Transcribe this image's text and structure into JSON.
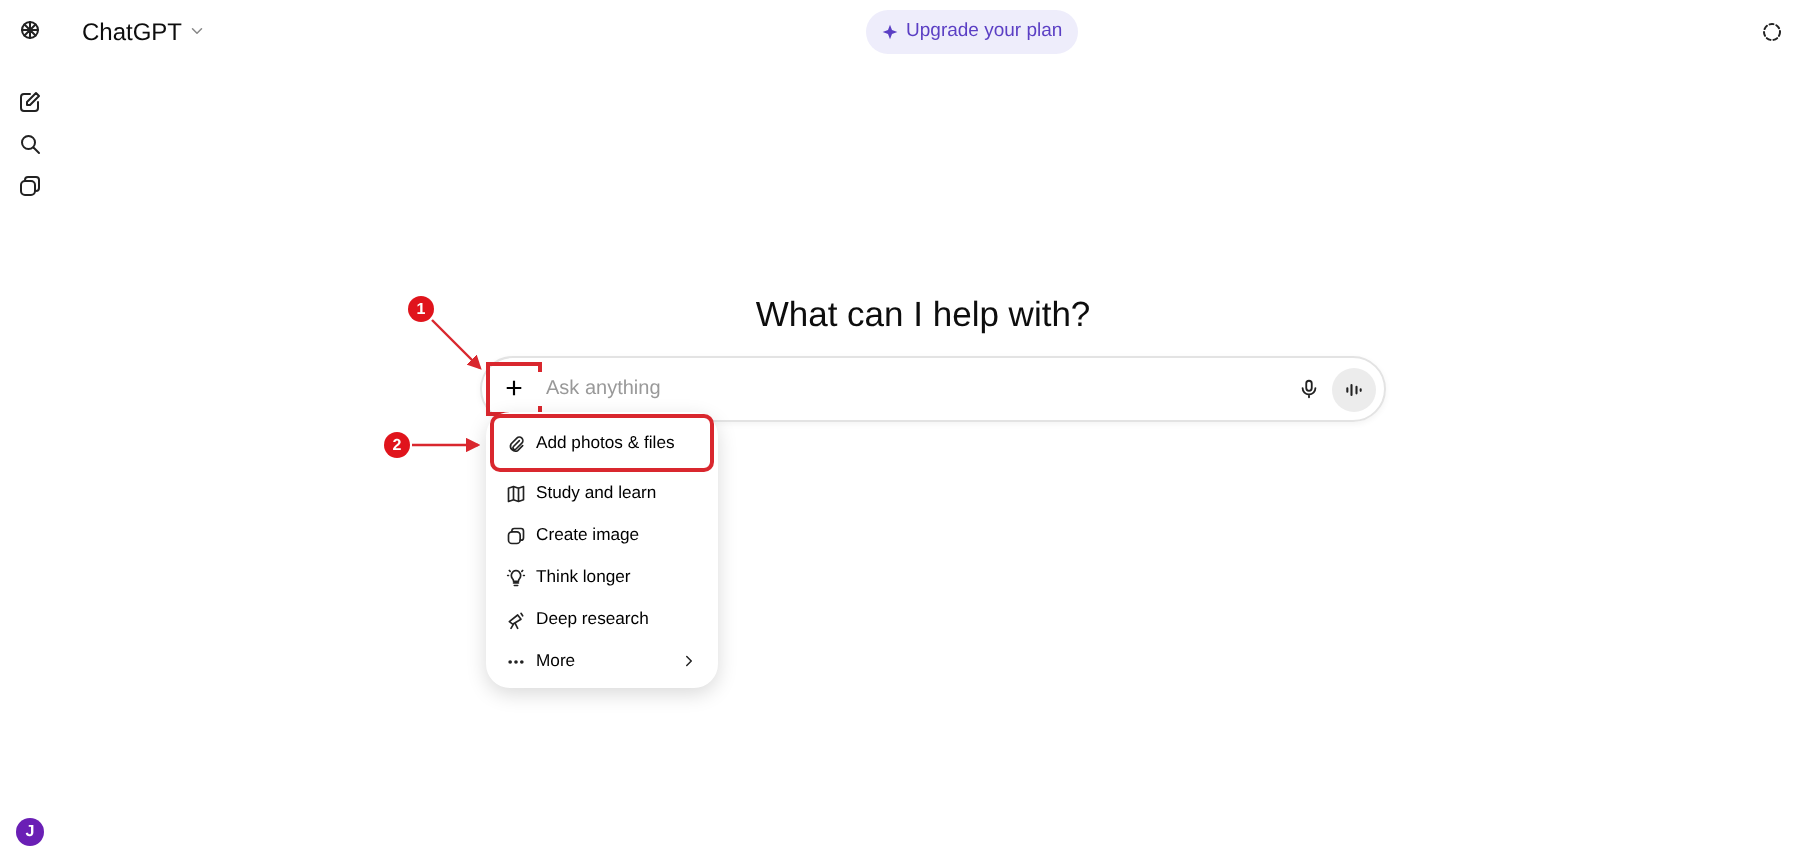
{
  "header": {
    "title": "ChatGPT",
    "upgrade": "Upgrade your plan"
  },
  "avatar": {
    "initial": "J"
  },
  "heading": "What can I help with?",
  "composer": {
    "placeholder": "Ask anything",
    "plus": "+",
    "highlighted": true
  },
  "menu": [
    {
      "label": "Add photos & files",
      "highlighted": true,
      "submenu": false
    },
    {
      "label": "Study and learn",
      "highlighted": false,
      "submenu": false
    },
    {
      "label": "Create image",
      "highlighted": false,
      "submenu": false
    },
    {
      "label": "Think longer",
      "highlighted": false,
      "submenu": false
    },
    {
      "label": "Deep research",
      "highlighted": false,
      "submenu": false
    },
    {
      "label": "More",
      "highlighted": false,
      "submenu": true
    }
  ],
  "annotations": [
    {
      "label": "1"
    },
    {
      "label": "2"
    }
  ]
}
